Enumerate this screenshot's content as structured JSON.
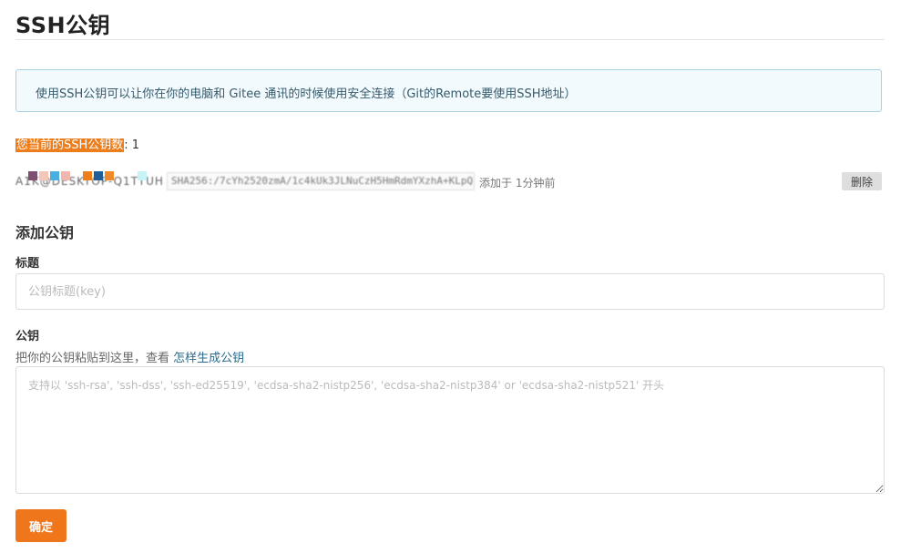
{
  "page": {
    "title": "SSH公钥"
  },
  "info": {
    "text": "使用SSH公钥可以让你在你的电脑和 Gitee 通讯的时候使用安全连接（Git的Remote要使用SSH地址）"
  },
  "key_count": {
    "label": "您当前的SSH公钥数",
    "value": ": 1"
  },
  "keys": [
    {
      "name": "A1K@DESKTOP-Q1TTUH",
      "fingerprint": "SHA256:/7cYh2520zmA/1c4kUk3JLNuCzH5HmRdmYXzhA+KLpQ",
      "added": "添加于 1分钟前",
      "delete_label": "删除"
    }
  ],
  "add_key": {
    "section_title": "添加公钥",
    "title_label": "标题",
    "title_placeholder": "公钥标题(key)",
    "key_label": "公钥",
    "help_prefix": "把你的公钥粘贴到这里，查看 ",
    "help_link": "怎样生成公钥",
    "key_placeholder": "支持以 'ssh-rsa', 'ssh-dss', 'ssh-ed25519', 'ecdsa-sha2-nistp256', 'ecdsa-sha2-nistp384' or 'ecdsa-sha2-nistp521' 开头",
    "submit_label": "确定"
  },
  "colors": {
    "accent": "#f0761c",
    "info_bg": "#f2fafd",
    "info_border": "#a8d2e3",
    "link": "#2b6b8c"
  }
}
